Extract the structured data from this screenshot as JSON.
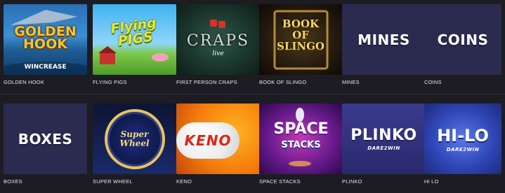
{
  "games": [
    {
      "label": "GOLDEN HOOK",
      "art_title": "GOLDEN HOOK",
      "art_sub": "WINCREASE"
    },
    {
      "label": "FLYING PIGS",
      "art_title": "Flying PIGS"
    },
    {
      "label": "FIRST PERSON CRAPS",
      "art_title": "CRAPS",
      "art_sub": "live"
    },
    {
      "label": "BOOK OF SLINGO",
      "art_title": "BOOK OF SLINGO"
    },
    {
      "label": "MINES",
      "art_title": "MINES"
    },
    {
      "label": "COINS",
      "art_title": "COINS"
    },
    {
      "label": "BOXES",
      "art_title": "BOXES"
    },
    {
      "label": "SUPER WHEEL",
      "art_title": "Super Wheel"
    },
    {
      "label": "KENO",
      "art_title": "KENO"
    },
    {
      "label": "SPACE STACKS",
      "art_title": "SPACE",
      "art_sub": "STACKS"
    },
    {
      "label": "PLINKO",
      "art_title": "PLINKO",
      "art_sub": "DARE2WIN"
    },
    {
      "label": "HI LO",
      "art_title": "HI-LO",
      "art_sub": "DARE2WIN"
    }
  ],
  "colors": {
    "page_bg": "#1c1c22",
    "plain_tile_bg": "#2b2a4f",
    "label_text": "#e6e6ea"
  }
}
